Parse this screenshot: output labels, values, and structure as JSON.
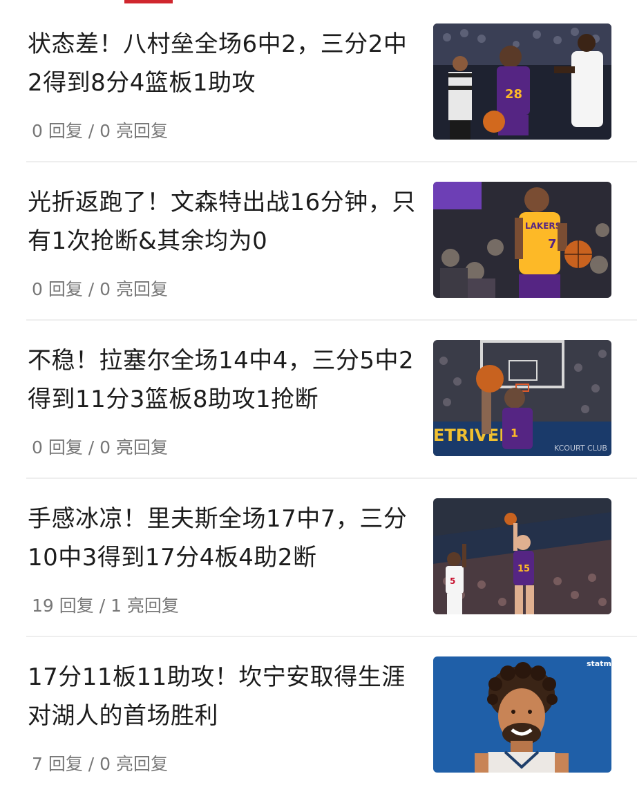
{
  "tab_indicator_color": "#d0262e",
  "news": [
    {
      "title": "状态差！八村垒全场6中2，三分2中2得到8分4篮板1助攻",
      "meta": "0 回复 / 0 亮回复",
      "image": "photo-hachimura-lakers-28-dribbling"
    },
    {
      "title": "光折返跑了！文森特出战16分钟，只有1次抢断&其余均为0",
      "meta": "0 回复 / 0 亮回复",
      "image": "photo-vincent-lakers-7-yellow"
    },
    {
      "title": "不稳！拉塞尔全场14中4，三分5中2得到11分3篮板8助攻1抢断",
      "meta": "0 回复 / 0 亮回复",
      "image": "photo-russell-shooting-under-hoop",
      "image_text": [
        "ETRIVER",
        "KCOURT CLUB"
      ]
    },
    {
      "title": "手感冰凉！里夫斯全场17中7，三分10中3得到17分4板4助2断",
      "meta": "19 回复 / 1 亮回复",
      "image": "photo-reaves-15-jump-shot"
    },
    {
      "title": "17分11板11助攻！坎宁安取得生涯对湖人的首场胜利",
      "meta": "7 回复 / 0 亮回复",
      "image": "illustration-cunningham-portrait",
      "image_text": [
        "statm"
      ]
    }
  ]
}
